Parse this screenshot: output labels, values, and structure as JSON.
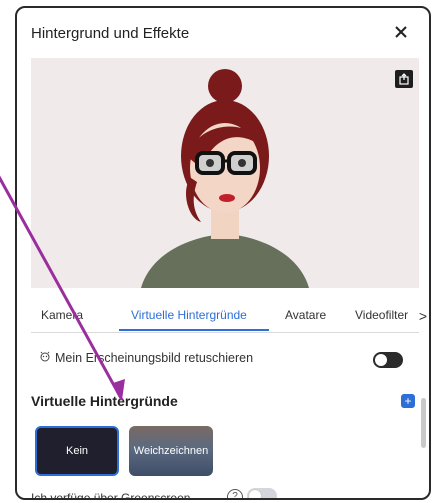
{
  "window": {
    "title": "Hintergrund und Effekte",
    "close_icon": "close-icon"
  },
  "preview": {
    "share_icon": "share-icon"
  },
  "tabs": [
    {
      "label": "Kamera",
      "active": false
    },
    {
      "label": "Virtuelle Hintergründe",
      "active": true
    },
    {
      "label": "Avatare",
      "active": false
    },
    {
      "label": "Videofilter",
      "active": false
    }
  ],
  "tabs_more_label": ">",
  "options": {
    "retouch_label": "Mein Erscheinungsbild retuschieren",
    "retouch_enabled": false,
    "section_title": "Virtuelle Hintergründe",
    "add_label": "+",
    "backgrounds": [
      {
        "label": "Kein",
        "selected": true
      },
      {
        "label": "Weichzeichnen",
        "selected": false
      }
    ],
    "greenscreen_label": "Ich verfüge über Greenscreen",
    "greenscreen_enabled": false,
    "help_label": "?"
  },
  "colors": {
    "accent": "#2d6fd6",
    "annotation_arrow": "#9b2e9f"
  }
}
